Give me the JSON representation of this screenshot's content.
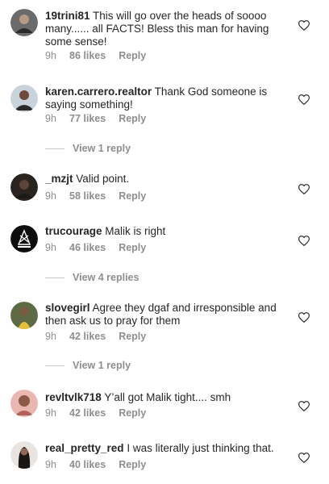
{
  "comments": [
    {
      "username": "19trini81",
      "text": "This will go over the heads of soooo many...... all FACTS! Bless this man for having some sense!",
      "time": "9h",
      "likes": "86 likes",
      "reply": "Reply"
    },
    {
      "username": "karen.carrero.realtor",
      "text": "Thank God someone is saying something!",
      "time": "9h",
      "likes": "77 likes",
      "reply": "Reply"
    },
    {
      "username": "_mzjt",
      "text": "Valid point.",
      "time": "9h",
      "likes": "58 likes",
      "reply": "Reply"
    },
    {
      "username": "trucourage",
      "text": "Malik is right",
      "time": "9h",
      "likes": "46 likes",
      "reply": "Reply"
    },
    {
      "username": "slovegirl",
      "text": "Agree they dgaf and irresponsible and then ask us to pray for them",
      "time": "9h",
      "likes": "42 likes",
      "reply": "Reply"
    },
    {
      "username": "revltvlk718",
      "text": "Y’all got Malik tight.... smh",
      "time": "9h",
      "likes": "42 likes",
      "reply": "Reply"
    },
    {
      "username": "real_pretty_red",
      "text": "I was literally just thinking that.",
      "time": "9h",
      "likes": "40 likes",
      "reply": "Reply"
    }
  ],
  "view_replies": [
    "View 1 reply",
    "View 4 replies",
    "View 1 reply"
  ],
  "icons": {
    "like": "heart-outline-icon",
    "avatar": "user-avatar"
  },
  "colors": {
    "text": "#262626",
    "muted": "#8e8e8e",
    "divider": "#c7c7c7"
  }
}
